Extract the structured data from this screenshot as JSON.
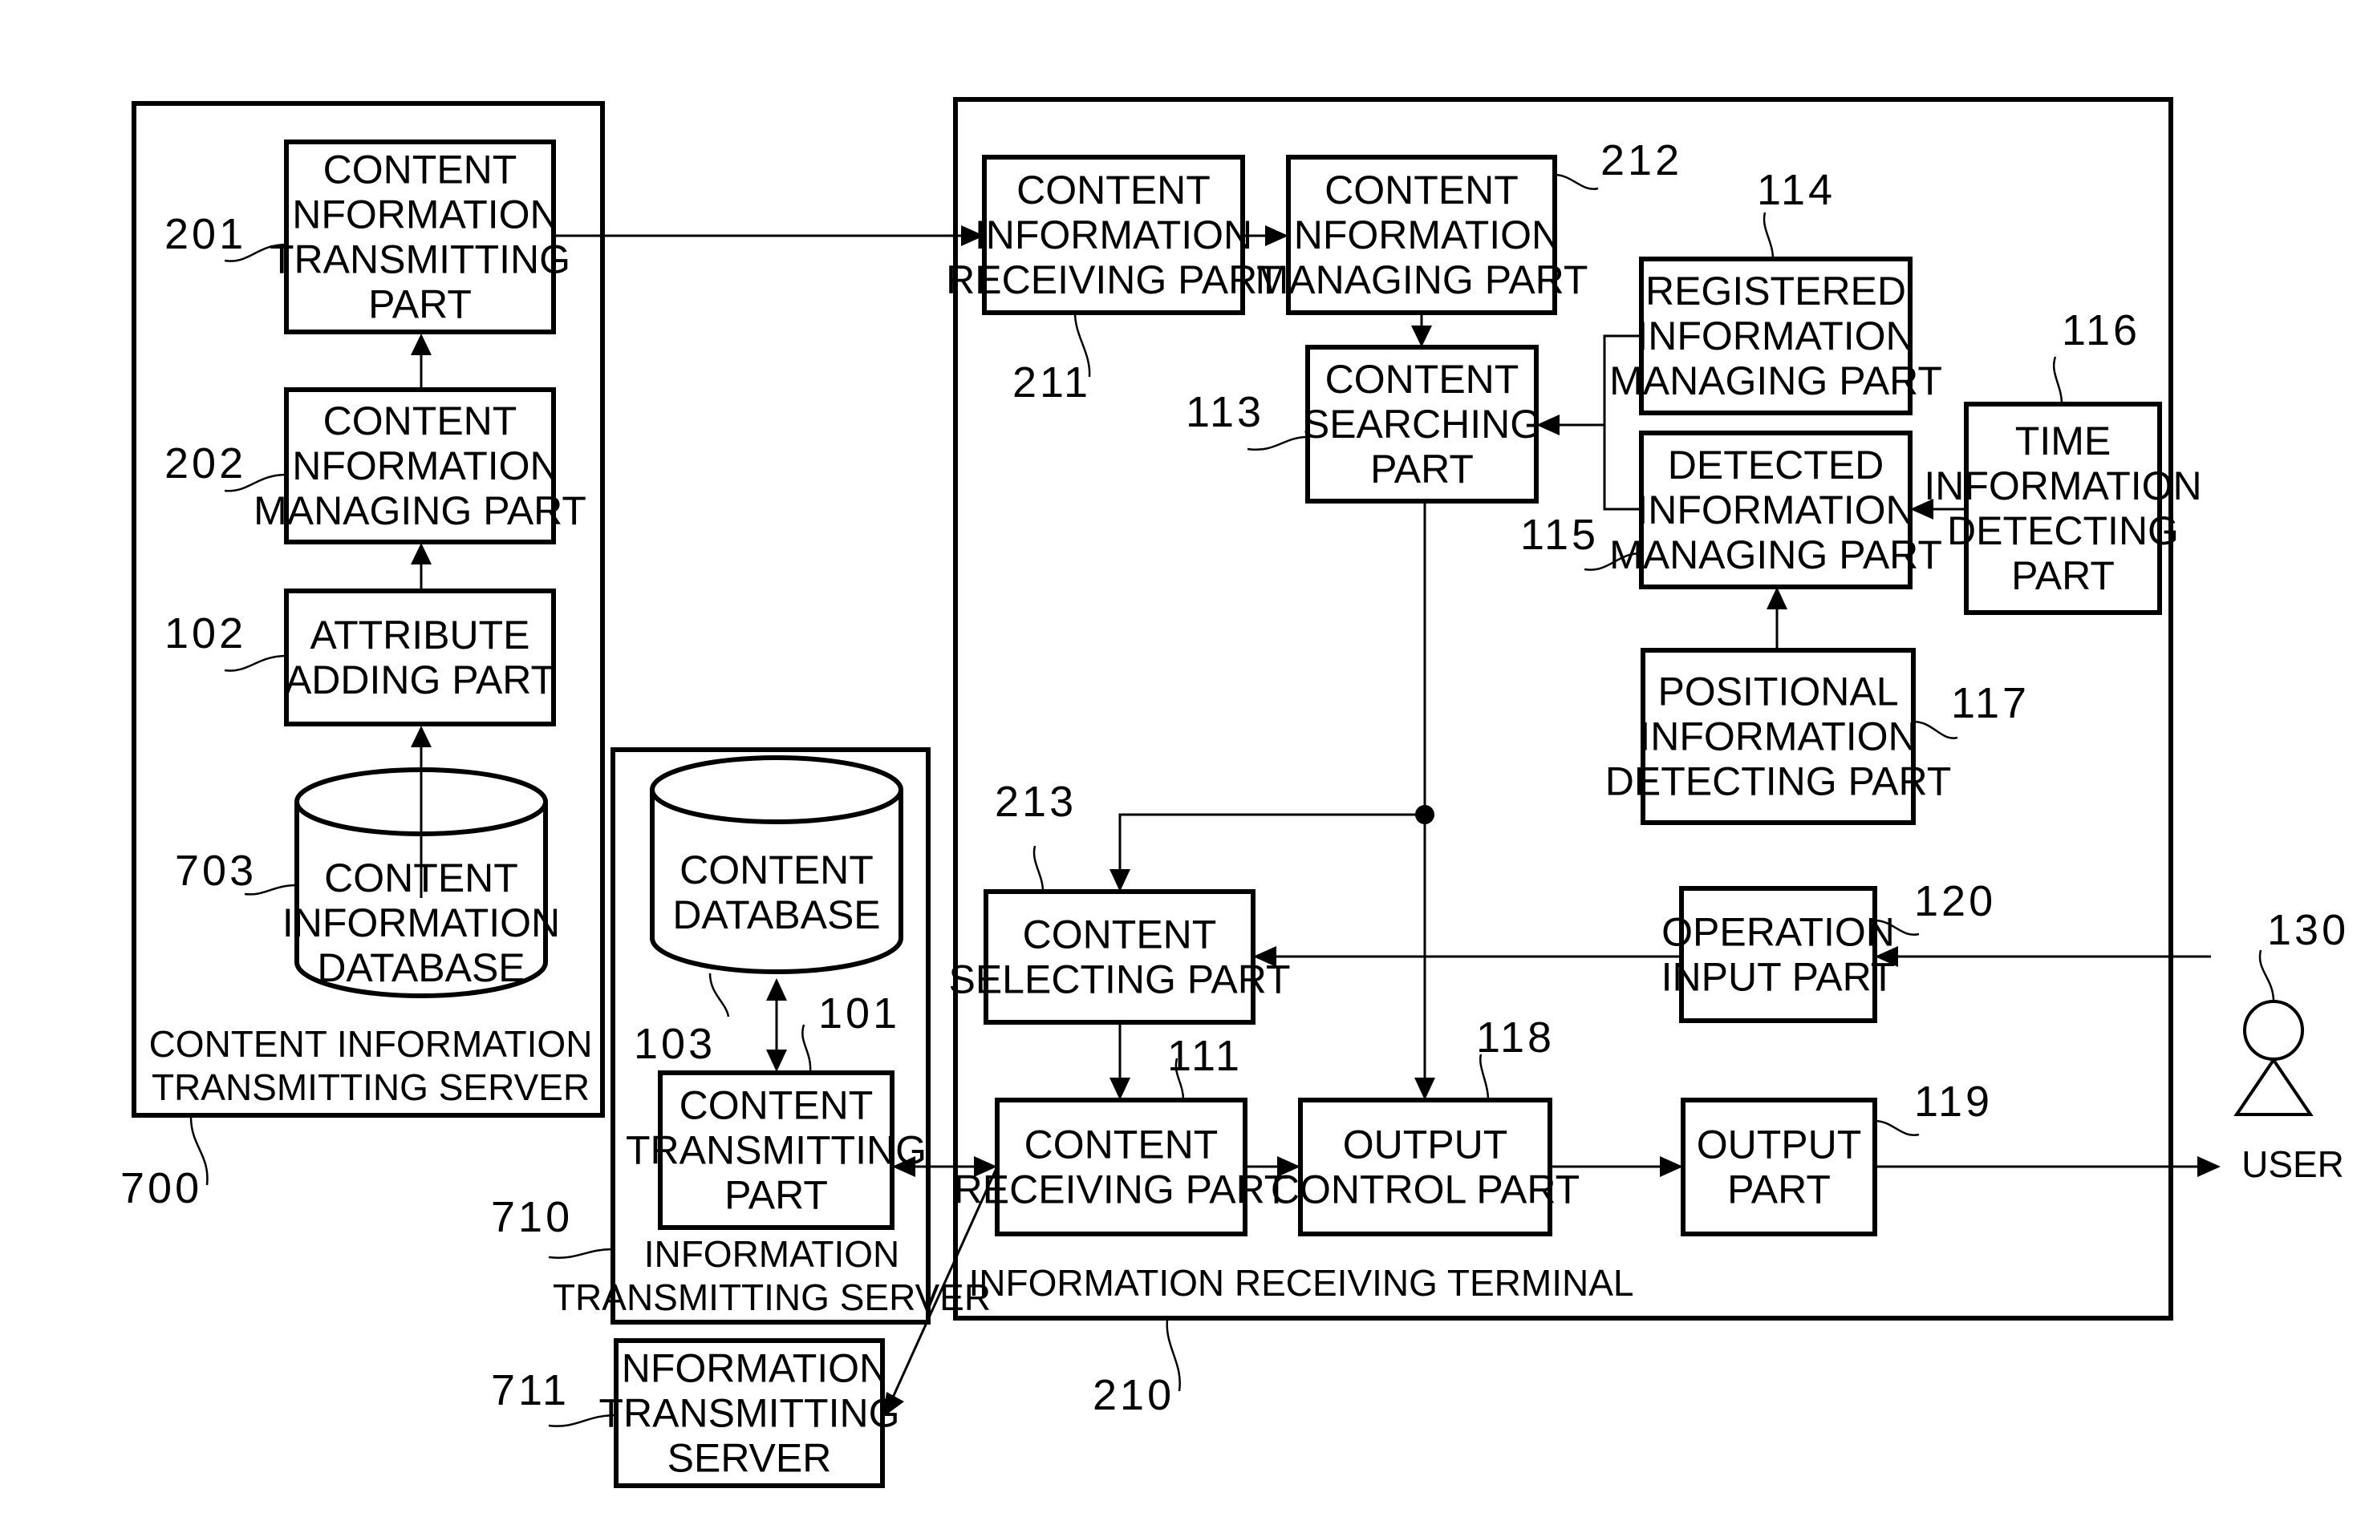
{
  "figure": {
    "containers": {
      "content_info_server": {
        "ref": "700",
        "caption": [
          "CONTENT INFORMATION",
          "TRANSMITTING SERVER"
        ]
      },
      "info_server_710": {
        "ref": "710",
        "caption": [
          "INFORMATION",
          "TRANSMITTING SERVER"
        ]
      },
      "terminal": {
        "ref": "210",
        "caption": [
          "INFORMATION RECEIVING TERMINAL"
        ]
      }
    },
    "blocks": {
      "b201": {
        "ref": "201",
        "lines": [
          "CONTENT",
          "INFORMATION",
          "TRANSMITTING",
          "PART"
        ]
      },
      "b202": {
        "ref": "202",
        "lines": [
          "CONTENT",
          "INFORMATION",
          "MANAGING PART"
        ]
      },
      "b102": {
        "ref": "102",
        "lines": [
          "ATTRIBUTE",
          "ADDING PART"
        ]
      },
      "b703": {
        "ref": "703",
        "lines": [
          "CONTENT",
          "INFORMATION",
          "DATABASE"
        ]
      },
      "b103": {
        "ref": "103",
        "lines": [
          "CONTENT",
          "DATABASE"
        ]
      },
      "b101": {
        "ref": "101",
        "lines": [
          "CONTENT",
          "TRANSMITTING",
          "PART"
        ]
      },
      "b711": {
        "ref": "711",
        "lines": [
          "INFORMATION",
          "TRANSMITTING",
          "SERVER"
        ]
      },
      "b211": {
        "ref": "211",
        "lines": [
          "CONTENT",
          "INFORMATION",
          "RECEIVING PART"
        ]
      },
      "b212": {
        "ref": "212",
        "lines": [
          "CONTENT",
          "INFORMATION",
          "MANAGING PART"
        ]
      },
      "b113": {
        "ref": "113",
        "lines": [
          "CONTENT",
          "SEARCHING",
          "PART"
        ]
      },
      "b114": {
        "ref": "114",
        "lines": [
          "REGISTERED",
          "INFORMATION",
          "MANAGING PART"
        ]
      },
      "b115": {
        "ref": "115",
        "lines": [
          "DETECTED",
          "INFORMATION",
          "MANAGING PART"
        ]
      },
      "b116": {
        "ref": "116",
        "lines": [
          "TIME",
          "INFORMATION",
          "DETECTING",
          "PART"
        ]
      },
      "b117": {
        "ref": "117",
        "lines": [
          "POSITIONAL",
          "INFORMATION",
          "DETECTING PART"
        ]
      },
      "b213": {
        "ref": "213",
        "lines": [
          "CONTENT",
          "SELECTING PART"
        ]
      },
      "b120": {
        "ref": "120",
        "lines": [
          "OPERATION",
          "INPUT PART"
        ]
      },
      "b111": {
        "ref": "111",
        "lines": [
          "CONTENT",
          "RECEIVING PART"
        ]
      },
      "b118": {
        "ref": "118",
        "lines": [
          "OUTPUT",
          "CONTROL PART"
        ]
      },
      "b119": {
        "ref": "119",
        "lines": [
          "OUTPUT",
          "PART"
        ]
      }
    },
    "user": {
      "ref": "130",
      "label": "USER"
    }
  }
}
